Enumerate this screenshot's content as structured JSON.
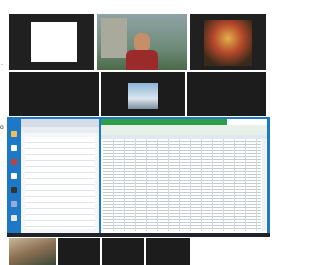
{
  "edge_glyph": ".",
  "edge_glyph_2": "o",
  "colors": {
    "call_bg": "#1c1c1c",
    "desktop_blue": "#1e78c8",
    "excel_green": "#2e9e4a",
    "excel_header": "#dfe7f0",
    "taskbar": "#202228"
  },
  "top_row": [
    {
      "name": "tile-whiteboard",
      "content": "blank-white"
    },
    {
      "name": "tile-man-webcam",
      "content": "man-in-red-shirt"
    },
    {
      "name": "tile-shrine-photo",
      "content": "decorated-altar"
    }
  ],
  "middle_row": [
    {
      "name": "tile-empty-1",
      "content": "empty"
    },
    {
      "name": "tile-avatar",
      "content": "profile-picture"
    },
    {
      "name": "tile-empty-2",
      "content": "empty"
    }
  ],
  "bottom_row": [
    {
      "name": "thumb-photo",
      "content": "photo"
    },
    {
      "name": "thumb-empty-1",
      "content": "empty"
    },
    {
      "name": "thumb-empty-2",
      "content": "empty"
    },
    {
      "name": "thumb-empty-3",
      "content": "empty"
    }
  ],
  "shared_screen": {
    "sidebar_icons": [
      "folder-icon",
      "settings-icon",
      "chart-icon",
      "doc-icon",
      "app-icon",
      "app-icon-2",
      "home-icon"
    ],
    "rows": 28
  }
}
